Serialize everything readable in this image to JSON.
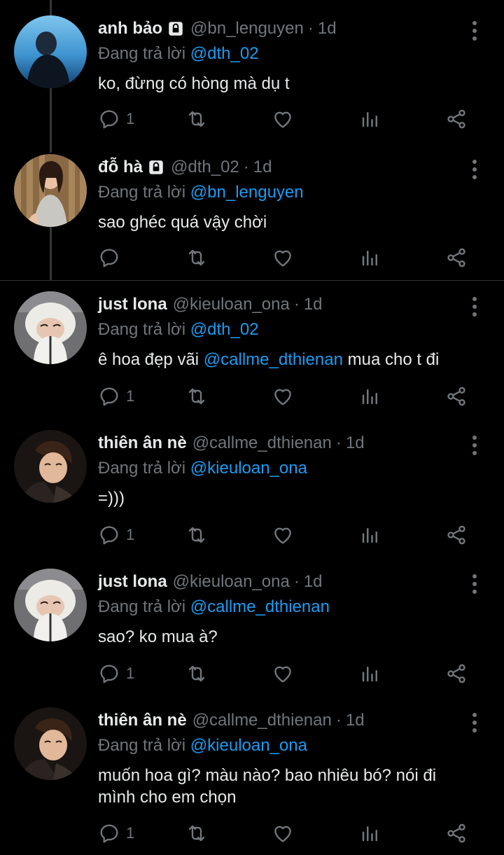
{
  "tweets": [
    {
      "name": "anh bảo",
      "locked": true,
      "handle": "@bn_lenguyen",
      "time": "1d",
      "reply_prefix": "Đang trả lời",
      "reply_to": "@dth_02",
      "text_parts": [
        "ko, đừng có hòng mà dụ t"
      ],
      "reply_count": "1",
      "avatar": "avatar-blue-sea"
    },
    {
      "name": "đỗ hà",
      "locked": true,
      "handle": "@dth_02",
      "time": "1d",
      "reply_prefix": "Đang trả lời",
      "reply_to": "@bn_lenguyen",
      "text_parts": [
        "sao ghéc quá vậy chời"
      ],
      "reply_count": "",
      "avatar": "avatar-girl-bamboo"
    },
    {
      "name": "just lona",
      "locked": false,
      "handle": "@kieuloan_ona",
      "time": "1d",
      "reply_prefix": "Đang trả lời",
      "reply_to": "@dth_02",
      "text_before": "ê hoa đẹp vãi ",
      "text_mention": "@callme_dthienan",
      "text_after": " mua cho t đi",
      "reply_count": "1",
      "avatar": "avatar-white-hat"
    },
    {
      "name": "thiên ân nè",
      "locked": false,
      "handle": "@callme_dthienan",
      "time": "1d",
      "reply_prefix": "Đang trả lời",
      "reply_to": "@kieuloan_ona",
      "text_parts": [
        "=)))"
      ],
      "reply_count": "1",
      "avatar": "avatar-boy-dark"
    },
    {
      "name": "just lona",
      "locked": false,
      "handle": "@kieuloan_ona",
      "time": "1d",
      "reply_prefix": "Đang trả lời",
      "reply_to": "@callme_dthienan",
      "text_parts": [
        "sao? ko mua à?"
      ],
      "reply_count": "1",
      "avatar": "avatar-white-hat"
    },
    {
      "name": "thiên ân nè",
      "locked": false,
      "handle": "@callme_dthienan",
      "time": "1d",
      "reply_prefix": "Đang trả lời",
      "reply_to": "@kieuloan_ona",
      "text_lines": [
        "muốn hoa gì? màu nào? bao nhiêu bó? nói đi",
        "mình cho em chọn"
      ],
      "reply_count": "1",
      "avatar": "avatar-boy-dark"
    }
  ],
  "separator": "·",
  "colors": {
    "background": "#000000",
    "text": "#e7e9ea",
    "muted": "#71767b",
    "accent": "#1d9bf0"
  },
  "icons": {
    "reply": "reply-icon",
    "retweet": "retweet-icon",
    "like": "heart-icon",
    "views": "views-icon",
    "share": "share-icon",
    "more": "more-options-icon",
    "lock": "lock-icon"
  }
}
